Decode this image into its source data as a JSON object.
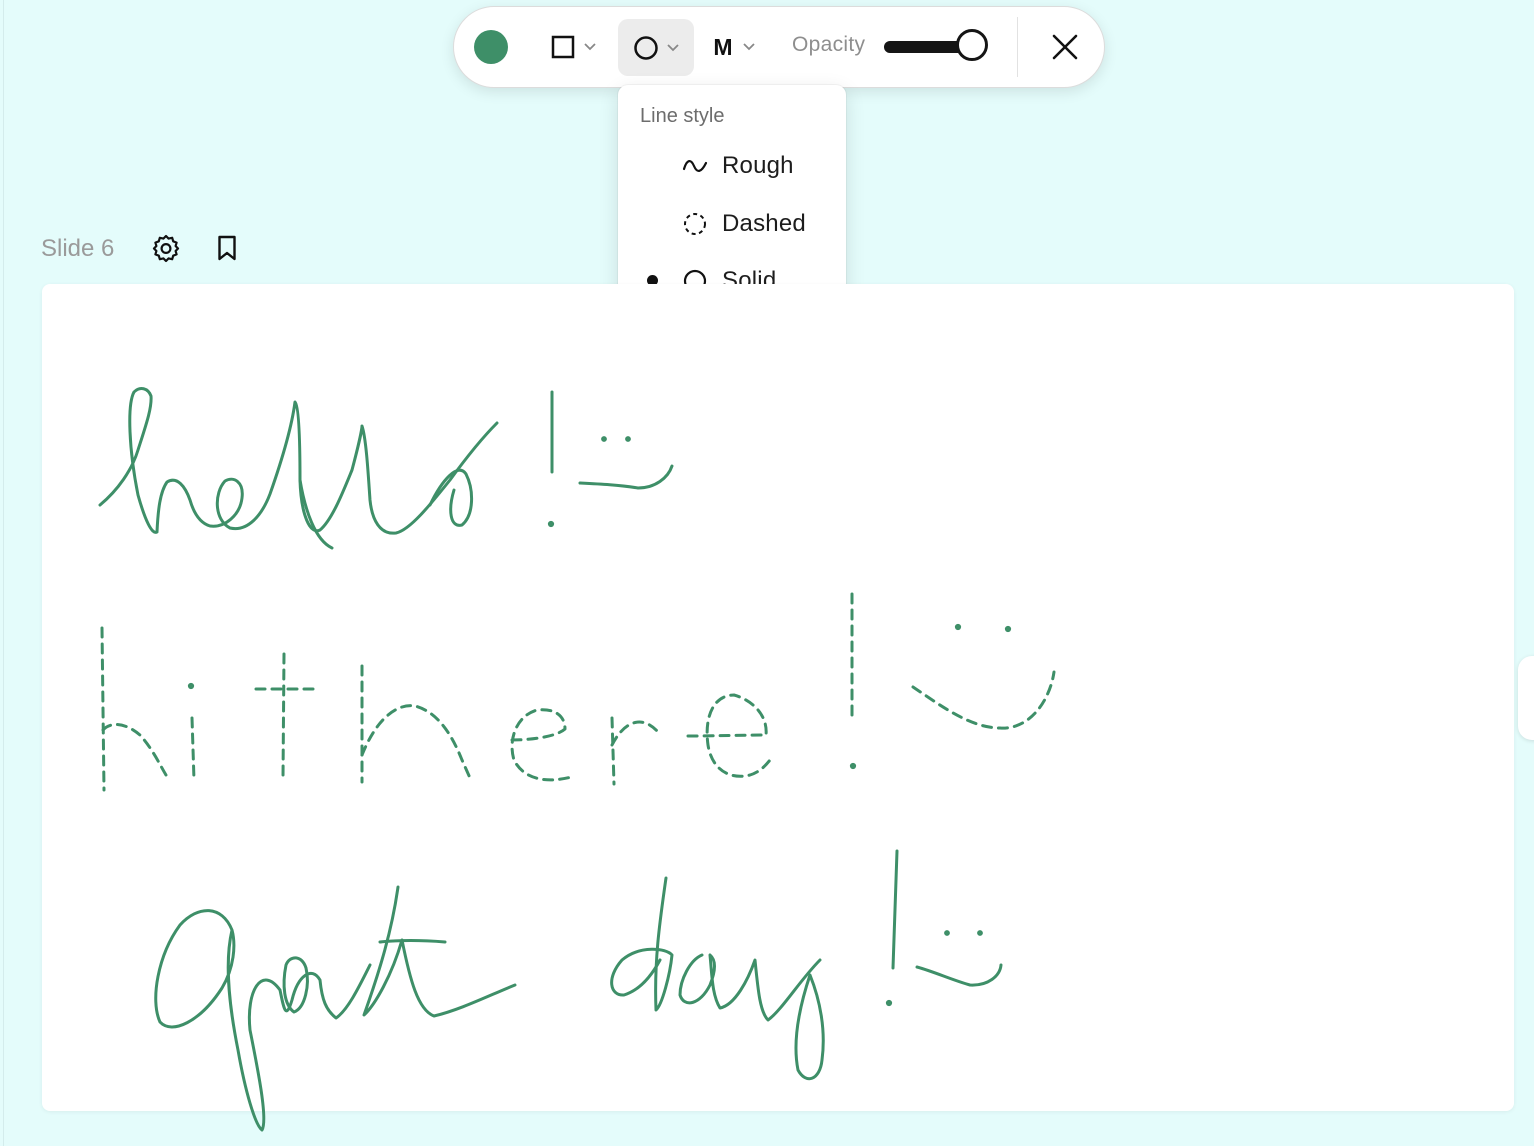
{
  "toolbar": {
    "color": "#3e8f68",
    "shape_icon": "square-icon",
    "line_style_icon": "circle-outline-icon",
    "size_label": "M",
    "opacity_label": "Opacity",
    "opacity_value": 1.0,
    "close_icon": "close-icon"
  },
  "line_style_menu": {
    "header": "Line style",
    "items": [
      {
        "label": "Rough",
        "icon": "wave-icon",
        "selected": false
      },
      {
        "label": "Dashed",
        "icon": "dashed-circle-icon",
        "selected": false
      },
      {
        "label": "Solid",
        "icon": "circle-outline-icon",
        "selected": true
      }
    ]
  },
  "slide": {
    "title": "Slide 6",
    "settings_icon": "gear-icon",
    "bookmark_icon": "bookmark-icon"
  },
  "canvas": {
    "ink_color": "#3e8f68",
    "drawings": [
      {
        "style": "solid",
        "content": "hello! with smiley"
      },
      {
        "style": "dashed",
        "content": "hi there! with smiley"
      },
      {
        "style": "solid",
        "content": "good day! with smiley"
      }
    ]
  }
}
